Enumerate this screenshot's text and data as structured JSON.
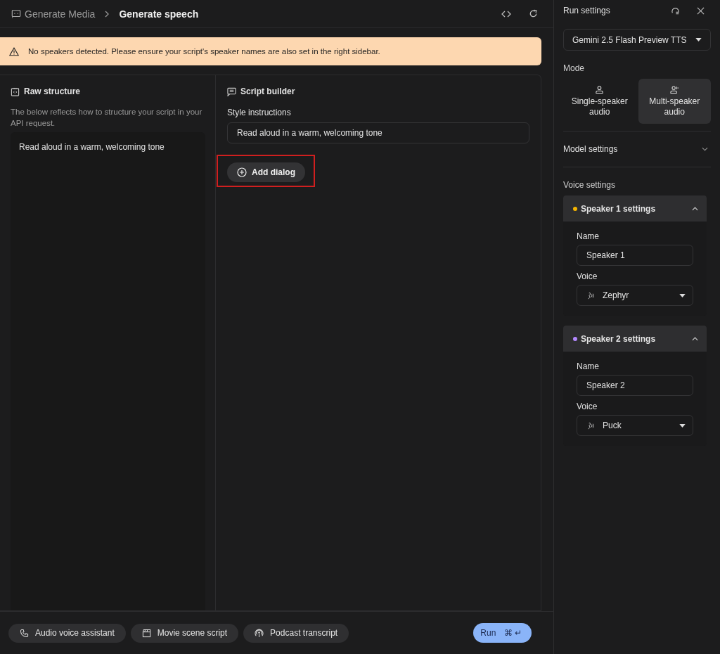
{
  "header": {
    "breadcrumb": "Generate Media",
    "title": "Generate speech"
  },
  "alert": {
    "message": "No speakers detected. Please ensure your script's speaker names are also set in the right sidebar."
  },
  "raw_structure": {
    "title": "Raw structure",
    "description": "The below reflects how to structure your script in your API request.",
    "content": "Read aloud in a warm, welcoming tone"
  },
  "script_builder": {
    "title": "Script builder",
    "style_label": "Style instructions",
    "style_value": "Read aloud in a warm, welcoming tone",
    "add_button": {
      "label": "Add dialog",
      "highlighted": true
    }
  },
  "presets": [
    {
      "label": "Audio voice assistant",
      "kind": "phone"
    },
    {
      "label": "Movie scene script",
      "kind": "clapper"
    },
    {
      "label": "Podcast transcript",
      "kind": "podcast"
    }
  ],
  "run_button": {
    "label": "Run",
    "shortcut": "⌘ ↵"
  },
  "sidebar": {
    "title": "Run settings",
    "model": "Gemini 2.5 Flash Preview TTS",
    "mode_label": "Mode",
    "modes": [
      {
        "label": "Single-speaker audio",
        "kind": "single",
        "selected": false
      },
      {
        "label": "Multi-speaker audio",
        "kind": "multi",
        "selected": true
      }
    ],
    "model_settings": {
      "label": "Model settings",
      "expanded": false
    },
    "voice_label": "Voice settings",
    "speakers": [
      {
        "title": "Speaker 1 settings",
        "color": "#f4b400",
        "expanded": true,
        "name_label": "Name",
        "name": "Speaker 1",
        "voice_label": "Voice",
        "voice": "Zephyr"
      },
      {
        "title": "Speaker 2 settings",
        "color": "#b388ff",
        "expanded": true,
        "name_label": "Name",
        "name": "Speaker 2",
        "voice_label": "Voice",
        "voice": "Puck"
      }
    ]
  }
}
